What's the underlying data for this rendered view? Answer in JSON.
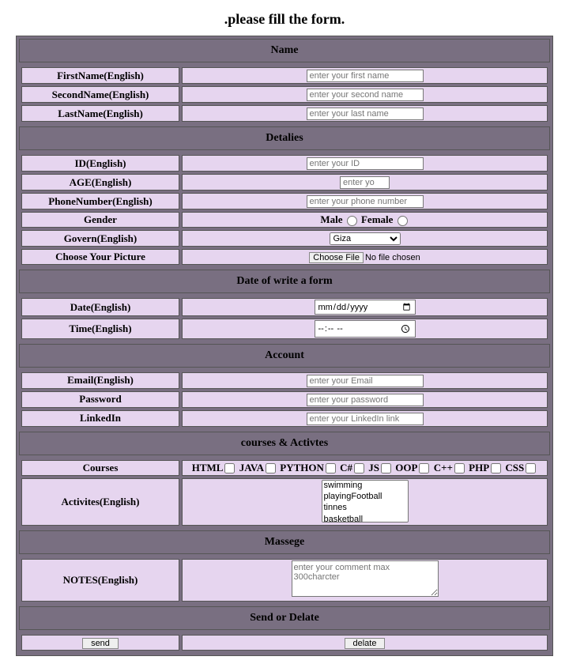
{
  "heading": ".please fill the form.",
  "sections": {
    "name": "Name",
    "details": "Detalies",
    "datewrite": "Date of write a form",
    "account": "Account",
    "courses": "courses & Activtes",
    "message": "Massege",
    "send": "Send or Delate"
  },
  "labels": {
    "firstName": "FirstName(English)",
    "secondName": "SecondName(English)",
    "lastName": "LastName(English)",
    "id": "ID(English)",
    "age": "AGE(English)",
    "phone": "PhoneNumber(English)",
    "gender": "Gender",
    "govern": "Govern(English)",
    "picture": "Choose Your Picture",
    "date": "Date(English)",
    "time": "Time(English)",
    "email": "Email(English)",
    "password": "Password",
    "linkedin": "LinkedIn",
    "courses": "Courses",
    "activities": "Activites(English)",
    "notes": "NOTES(English)"
  },
  "placeholders": {
    "firstName": "enter your first name",
    "secondName": "enter your second name",
    "lastName": "enter your last name",
    "id": "enter your ID",
    "age": "enter your age",
    "phone": "enter your phone number",
    "email": "enter your Email",
    "password": "enter your password",
    "linkedin": "enter your LinkedIn link",
    "notes": "enter your comment max 300charcter"
  },
  "gender": {
    "male": "Male",
    "female": "Female"
  },
  "govern": {
    "selected": "Giza"
  },
  "file": {
    "button": "Choose File",
    "status": "No file chosen"
  },
  "dateValue": "mm/dd/yyyy",
  "timeValue": "--:-- --",
  "courseList": [
    "HTML",
    "JAVA",
    "PYTHON",
    "C#",
    "JS",
    "OOP",
    "C++",
    "PHP",
    "CSS"
  ],
  "activities": [
    "swimming",
    "playingFootball",
    "tinnes",
    "basketball"
  ],
  "buttons": {
    "send": "send",
    "delete": "delate"
  }
}
